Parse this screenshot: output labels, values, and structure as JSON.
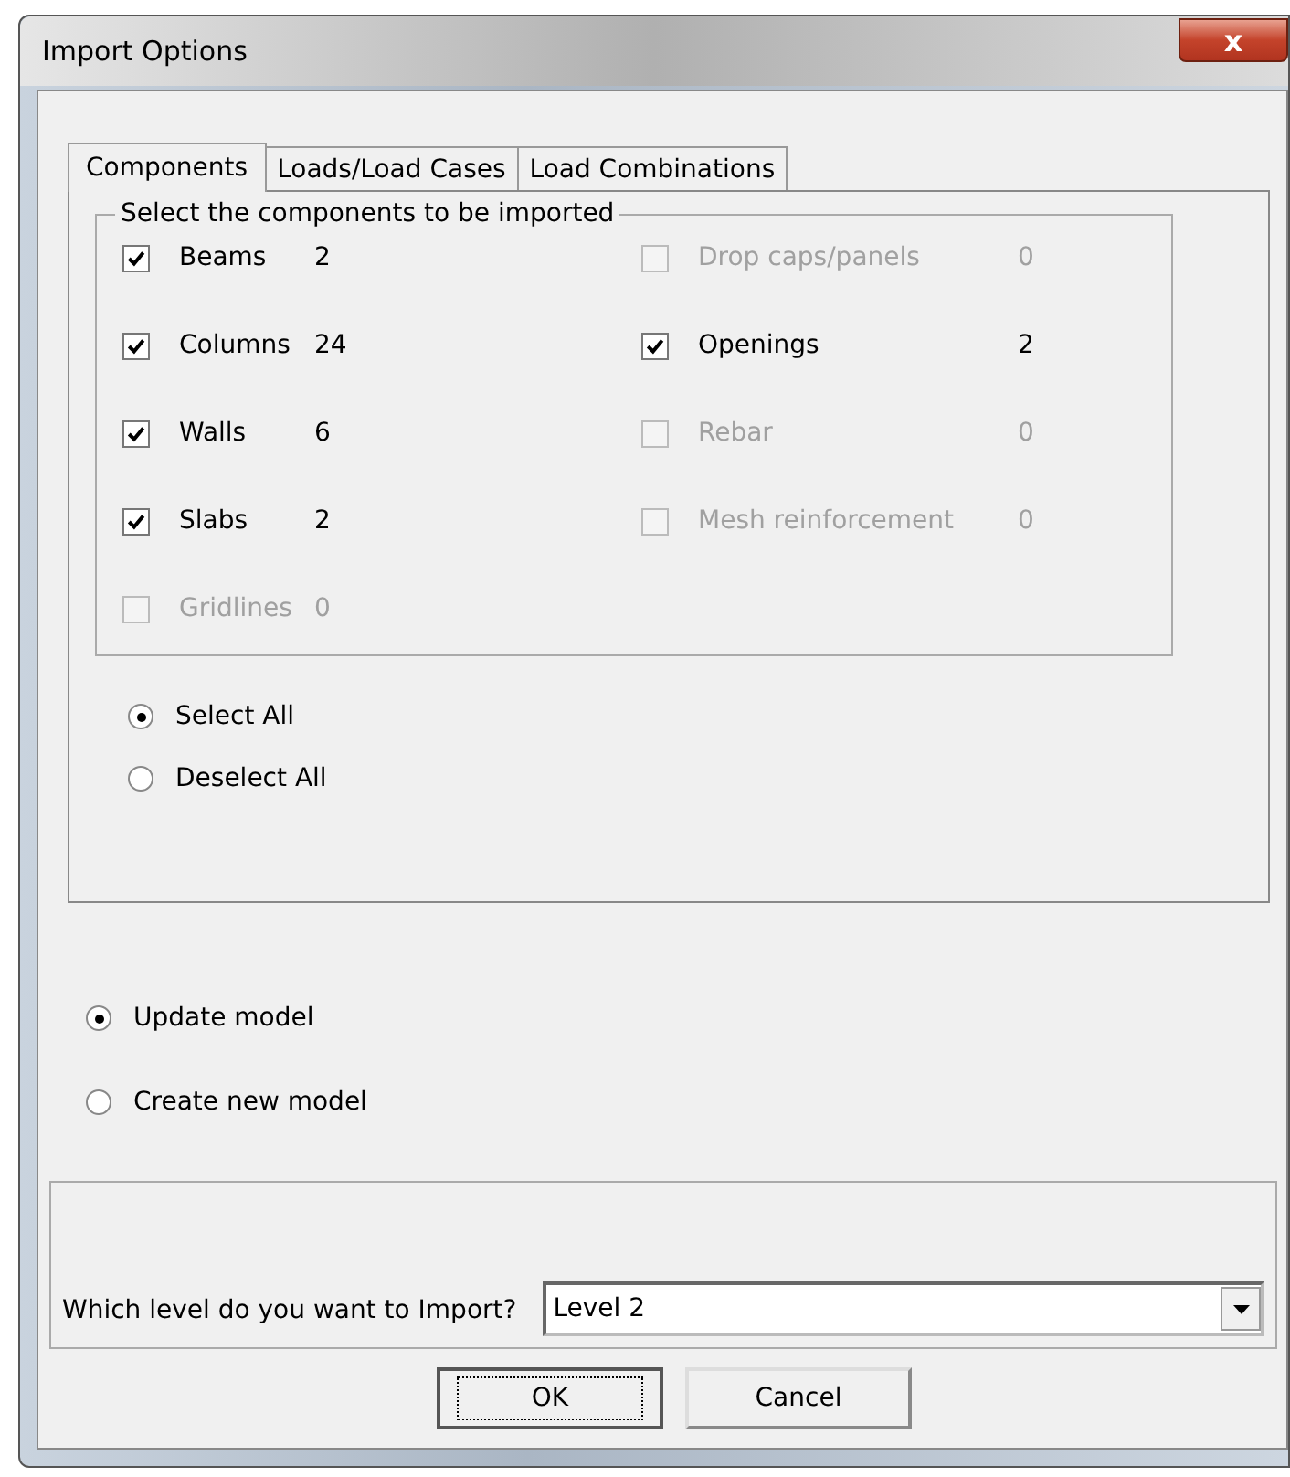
{
  "window": {
    "title": "Import Options",
    "close": "x"
  },
  "tabs": [
    {
      "label": "Components",
      "selected": true
    },
    {
      "label": "Loads/Load Cases",
      "selected": false
    },
    {
      "label": "Load Combinations",
      "selected": false
    }
  ],
  "group": {
    "title": "Select the components to be imported",
    "left": [
      {
        "label": "Beams",
        "count": "2",
        "checked": true,
        "disabled": false
      },
      {
        "label": "Columns",
        "count": "24",
        "checked": true,
        "disabled": false
      },
      {
        "label": "Walls",
        "count": "6",
        "checked": true,
        "disabled": false
      },
      {
        "label": "Slabs",
        "count": "2",
        "checked": true,
        "disabled": false
      },
      {
        "label": "Gridlines",
        "count": "0",
        "checked": false,
        "disabled": true
      }
    ],
    "right": [
      {
        "label": "Drop caps/panels",
        "count": "0",
        "checked": false,
        "disabled": true
      },
      {
        "label": "Openings",
        "count": "2",
        "checked": true,
        "disabled": false
      },
      {
        "label": "Rebar",
        "count": "0",
        "checked": false,
        "disabled": true
      },
      {
        "label": "Mesh reinforcement",
        "count": "0",
        "checked": false,
        "disabled": true
      }
    ]
  },
  "selection": [
    {
      "label": "Select All",
      "selected": true
    },
    {
      "label": "Deselect All",
      "selected": false
    }
  ],
  "mode": [
    {
      "label": "Update model",
      "selected": true
    },
    {
      "label": "Create new model",
      "selected": false
    }
  ],
  "level": {
    "label": "Which level do you want to Import?",
    "value": "Level 2"
  },
  "buttons": [
    {
      "label": "OK",
      "default": true
    },
    {
      "label": "Cancel",
      "default": false
    }
  ]
}
